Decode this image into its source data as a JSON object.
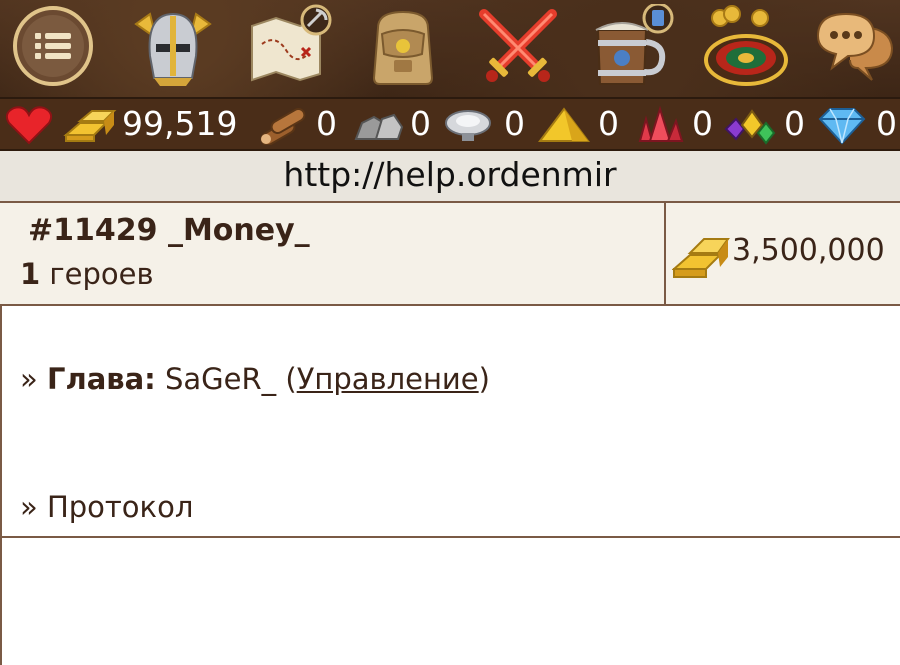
{
  "nav": {
    "items": [
      {
        "name": "menu-icon"
      },
      {
        "name": "knight-helmet-icon"
      },
      {
        "name": "treasure-map-icon"
      },
      {
        "name": "backpack-icon"
      },
      {
        "name": "crossed-swords-icon"
      },
      {
        "name": "tavern-mug-icon"
      },
      {
        "name": "roulette-icon"
      },
      {
        "name": "chat-icon"
      }
    ]
  },
  "resources": {
    "gold": "99,519",
    "wood": "0",
    "stone": "0",
    "mercury": "0",
    "sulfur": "0",
    "crystals": "0",
    "gems": "0",
    "diamonds": "0"
  },
  "url": "http://help.ordenmir",
  "clan": {
    "id_name": "#11429 _Money_",
    "heroes_count": "1",
    "heroes_label": " героев",
    "gold": "3,500,000"
  },
  "info": {
    "leader_prefix": "» ",
    "leader_label": "Глава:",
    "leader_name": " SaGeR_  (",
    "manage_link": "Управление",
    "close_paren": ")",
    "protocol": "» Протокол"
  },
  "colors": {
    "topbar": "#4a2f1b",
    "resbar": "#4a2d18",
    "border": "#7a5a45",
    "text": "#3a2418"
  }
}
